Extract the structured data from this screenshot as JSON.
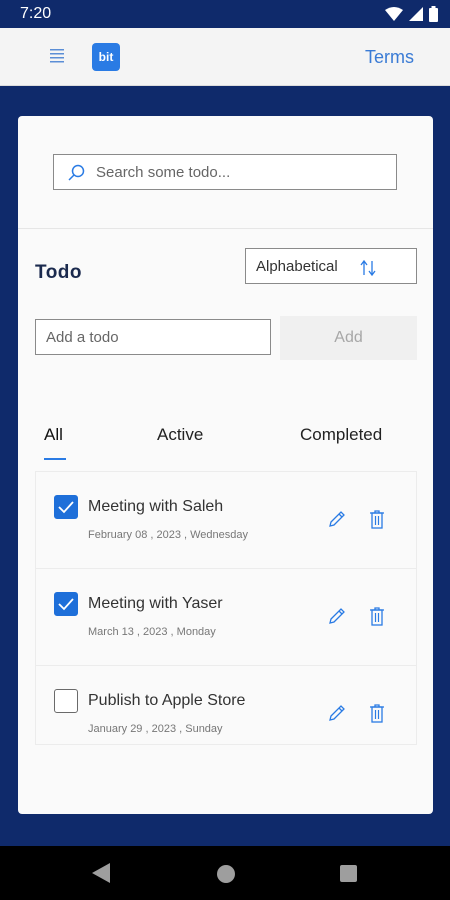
{
  "status_bar": {
    "time": "7:20"
  },
  "app_bar": {
    "logo_text": "bit",
    "terms_label": "Terms"
  },
  "search": {
    "placeholder": "Search some todo..."
  },
  "todo": {
    "title": "Todo",
    "sort_label": "Alphabetical",
    "add_placeholder": "Add a todo",
    "add_button": "Add"
  },
  "tabs": [
    {
      "label": "All",
      "selected": true
    },
    {
      "label": "Active",
      "selected": false
    },
    {
      "label": "Completed",
      "selected": false
    }
  ],
  "items": [
    {
      "title": "Meeting with Saleh",
      "date": "February 08 , 2023 , Wednesday",
      "done": true
    },
    {
      "title": "Meeting with Yaser",
      "date": "March 13 , 2023 , Monday",
      "done": true
    },
    {
      "title": "Publish to Apple Store",
      "date": "January 29 , 2023 , Sunday",
      "done": false
    }
  ],
  "colors": {
    "brand_navy": "#0f2a6b",
    "accent_blue": "#2a7be4",
    "checkbox_blue": "#1e6fd9"
  }
}
